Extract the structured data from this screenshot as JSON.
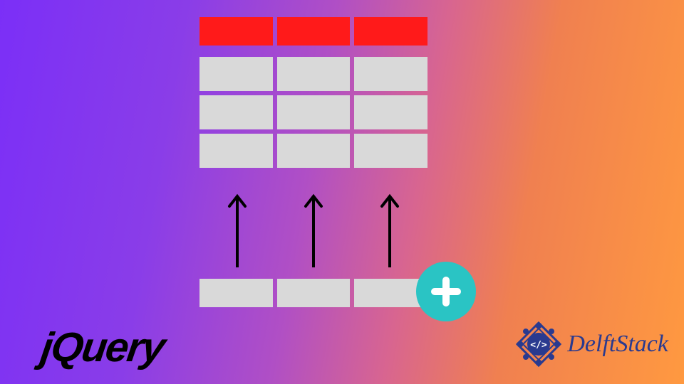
{
  "diagram": {
    "concept": "Append table row with jQuery",
    "columns": 3,
    "header_cells": [
      "",
      "",
      ""
    ],
    "body_rows": [
      [
        "",
        "",
        ""
      ],
      [
        "",
        "",
        ""
      ],
      [
        "",
        "",
        ""
      ]
    ],
    "new_row": [
      "",
      "",
      ""
    ],
    "arrow_direction": "up",
    "add_button_symbol": "+",
    "colors": {
      "header": "#ff1a1a",
      "cell": "#d9d9d9",
      "add_button": "#2ac4c4",
      "add_button_plus": "#ffffff",
      "arrow": "#000000"
    }
  },
  "logos": {
    "jquery": "jQuery",
    "delftstack": "DelftStack",
    "delftstack_glyph": "</>"
  }
}
